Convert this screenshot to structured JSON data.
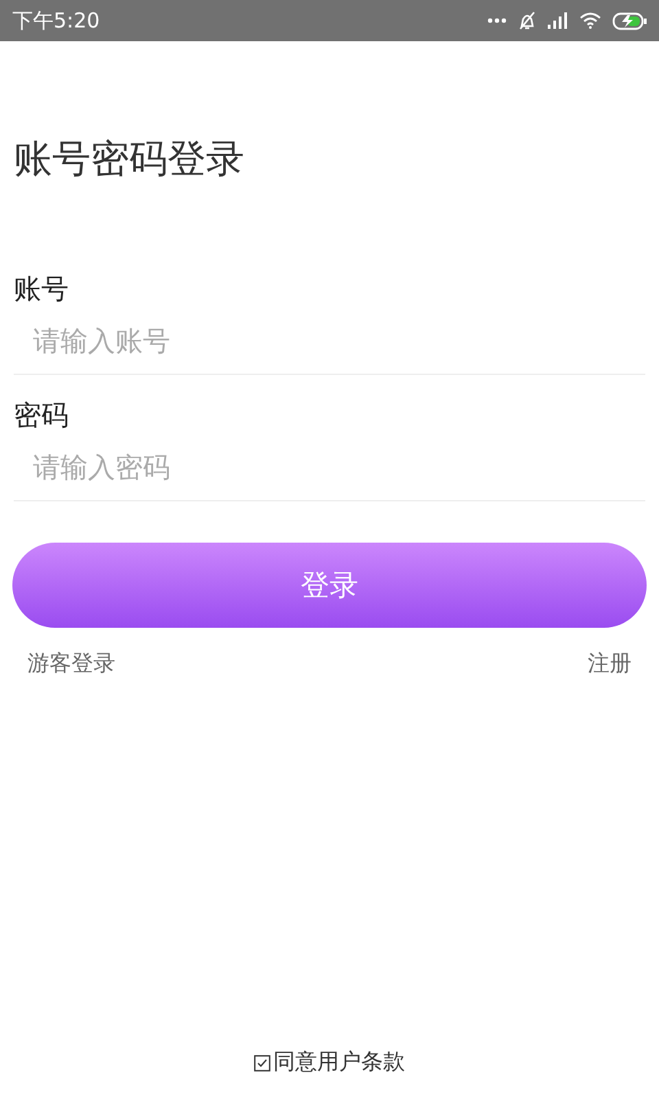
{
  "status_bar": {
    "time": "下午5:20"
  },
  "title": "账号密码登录",
  "fields": [
    {
      "label": "账号",
      "placeholder": "请输入账号"
    },
    {
      "label": "密码",
      "placeholder": "请输入密码"
    }
  ],
  "login_button": "登录",
  "links": {
    "guest": "游客登录",
    "register": "注册"
  },
  "agreement": {
    "checked": true,
    "text": "同意用户条款"
  }
}
